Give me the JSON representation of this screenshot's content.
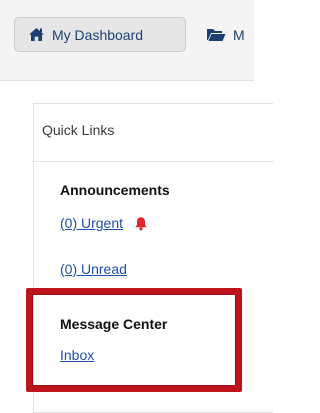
{
  "topnav": {
    "dashboard_label": "My Dashboard",
    "messages_label": "M",
    "dashboard_icon": "home-icon",
    "messages_icon": "folder-open-icon"
  },
  "quick_links": {
    "title": "Quick Links",
    "announcements": {
      "heading": "Announcements",
      "urgent_label": "(0) Urgent",
      "urgent_icon": "bell-icon",
      "unread_label": "(0) Unread"
    },
    "message_center": {
      "heading": "Message Center",
      "inbox_label": "Inbox"
    }
  },
  "colors": {
    "link": "#1f4fa8",
    "nav_text": "#1c3f73",
    "highlight": "#c0141b",
    "bell": "#e2252b"
  }
}
